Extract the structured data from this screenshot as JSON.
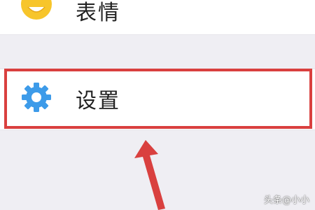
{
  "menu": {
    "items": [
      {
        "label": "表情",
        "icon": "smiley-face-icon"
      },
      {
        "label": "设置",
        "icon": "gear-icon"
      }
    ]
  },
  "annotation": {
    "highlight_color": "#d9403f",
    "arrow_color": "#d9403f"
  },
  "watermark": {
    "text": "头条@小小"
  },
  "colors": {
    "background": "#efeef3",
    "row_background": "#ffffff",
    "gear_icon": "#3d9be9",
    "emoji_icon": "#f7c52b"
  }
}
